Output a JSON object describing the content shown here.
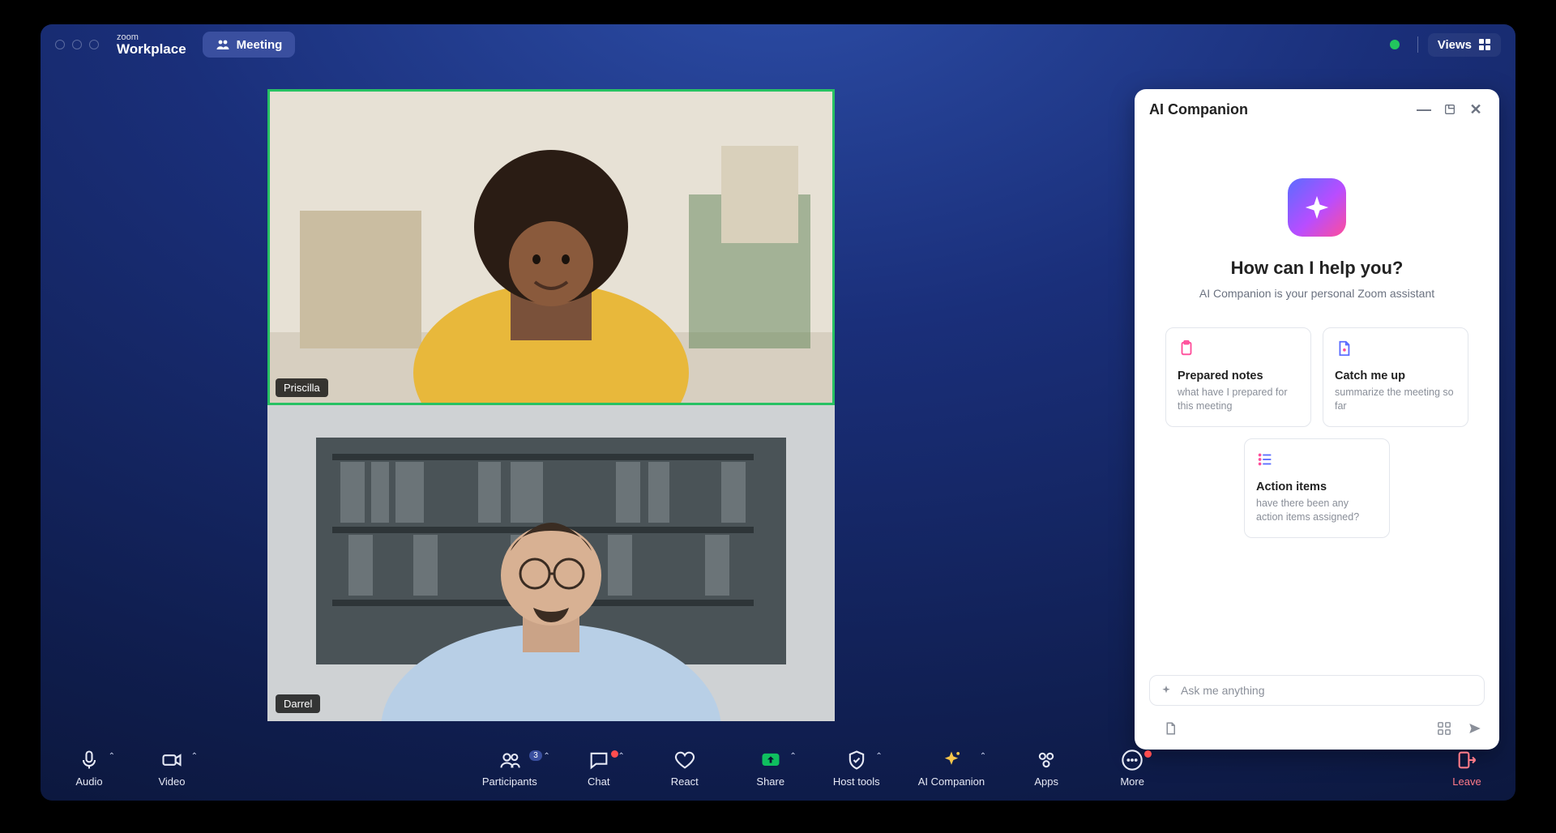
{
  "brand": {
    "top": "zoom",
    "bottom": "Workplace"
  },
  "header": {
    "meeting_pill": "Meeting",
    "views": "Views"
  },
  "participants": [
    {
      "name": "Priscilla",
      "active": true
    },
    {
      "name": "Darrel",
      "active": false
    }
  ],
  "ai_panel": {
    "title": "AI Companion",
    "heading": "How can I help you?",
    "subtitle": "AI Companion is your personal Zoom assistant",
    "cards": [
      {
        "title": "Prepared notes",
        "subtitle": "what have I prepared for this meeting"
      },
      {
        "title": "Catch me up",
        "subtitle": "summarize the meeting so far"
      },
      {
        "title": "Action items",
        "subtitle": "have there been any action items assigned?"
      }
    ],
    "ask_placeholder": "Ask me anything"
  },
  "toolbar": {
    "audio": "Audio",
    "video": "Video",
    "participants": "Participants",
    "participants_count": "3",
    "chat": "Chat",
    "react": "React",
    "share": "Share",
    "host_tools": "Host tools",
    "ai_companion": "AI Companion",
    "apps": "Apps",
    "more": "More",
    "leave": "Leave"
  }
}
